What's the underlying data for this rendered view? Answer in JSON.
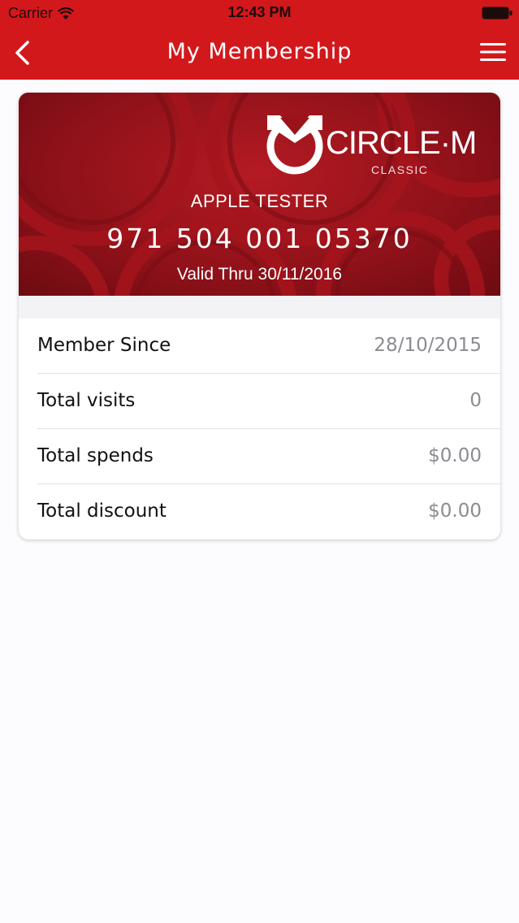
{
  "status_bar": {
    "carrier": "Carrier",
    "time": "12:43 PM"
  },
  "nav": {
    "title": "My Membership",
    "back_icon": "chevron-left-icon",
    "menu_icon": "hamburger-menu-icon"
  },
  "membership_card": {
    "brand": "CIRCLE·M",
    "tier": "CLASSIC",
    "holder_name": "APPLE TESTER",
    "number": "971 504 001 05370",
    "valid_thru": "Valid Thru 30/11/2016"
  },
  "details": [
    {
      "label": "Member Since",
      "value": "28/10/2015"
    },
    {
      "label": "Total visits",
      "value": "0"
    },
    {
      "label": "Total spends",
      "value": "$0.00"
    },
    {
      "label": "Total discount",
      "value": "$0.00"
    }
  ],
  "colors": {
    "accent": "#d3181c",
    "card_red": "#8e1119",
    "value_gray": "#8c8b91"
  }
}
